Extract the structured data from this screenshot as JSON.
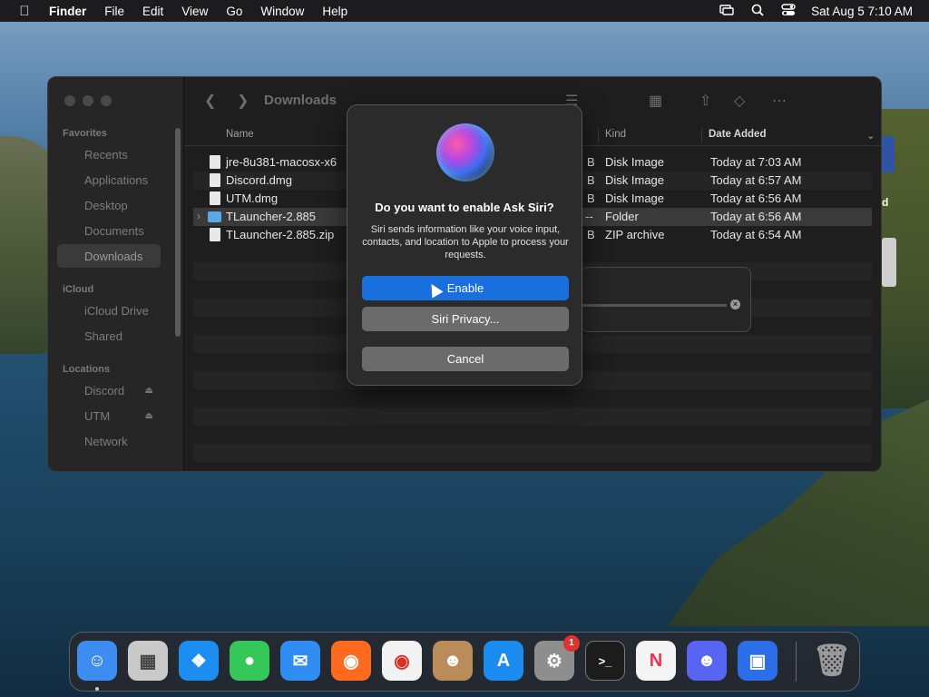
{
  "menubar": {
    "app_name": "Finder",
    "items": [
      "File",
      "Edit",
      "View",
      "Go",
      "Window",
      "Help"
    ],
    "clock": "Sat Aug 5  7:10 AM",
    "right_icons": [
      "screen-mirroring-icon",
      "search-icon",
      "control-center-icon"
    ]
  },
  "finder": {
    "title": "Downloads",
    "sidebar": {
      "favorites_label": "Favorites",
      "favorites": [
        "Recents",
        "Applications",
        "Desktop",
        "Documents",
        "Downloads"
      ],
      "icloud_label": "iCloud",
      "icloud": [
        "iCloud Drive",
        "Shared"
      ],
      "locations_label": "Locations",
      "locations": [
        "Discord",
        "UTM",
        "Network"
      ]
    },
    "columns": {
      "name": "Name",
      "kind": "Kind",
      "date_added": "Date Added"
    },
    "files": [
      {
        "name": "jre-8u381-macosx-x6",
        "size_tail": "B",
        "kind": "Disk Image",
        "date": "Today at 7:03 AM"
      },
      {
        "name": "Discord.dmg",
        "size_tail": "B",
        "kind": "Disk Image",
        "date": "Today at 6:57 AM"
      },
      {
        "name": "UTM.dmg",
        "size_tail": "B",
        "kind": "Disk Image",
        "date": "Today at 6:56 AM"
      },
      {
        "name": "TLauncher-2.885",
        "size_tail": "--",
        "kind": "Folder",
        "date": "Today at 6:56 AM"
      },
      {
        "name": "TLauncher-2.885.zip",
        "size_tail": "B",
        "kind": "ZIP archive",
        "date": "Today at 6:54 AM"
      }
    ]
  },
  "dialog": {
    "title": "Do you want to enable Ask Siri?",
    "body": "Siri sends information like your voice input, contacts, and location to Apple to process your requests.",
    "enable_label": "Enable",
    "privacy_label": "Siri Privacy...",
    "cancel_label": "Cancel"
  },
  "desktop": {
    "right_label": "d"
  },
  "dock": {
    "apps": [
      {
        "name": "Finder",
        "color": "#3d8df0"
      },
      {
        "name": "Launchpad",
        "color": "#c9c9c9"
      },
      {
        "name": "Safari",
        "color": "#1c8ef2"
      },
      {
        "name": "Messages",
        "color": "#34c759"
      },
      {
        "name": "Mail",
        "color": "#2f8cf0"
      },
      {
        "name": "Firefox",
        "color": "#ff6a1f"
      },
      {
        "name": "Chrome",
        "color": "#f2f2f2"
      },
      {
        "name": "Contacts",
        "color": "#b98c5a"
      },
      {
        "name": "App Store",
        "color": "#1a8cf0"
      },
      {
        "name": "System Settings",
        "color": "#8e8e8e"
      },
      {
        "name": "Terminal",
        "color": "#1c1c1c"
      },
      {
        "name": "News",
        "color": "#f4f4f4"
      },
      {
        "name": "Discord",
        "color": "#5865f2"
      },
      {
        "name": "UTM",
        "color": "#2b6ee8"
      }
    ],
    "settings_badge": "1",
    "trash_name": "Trash"
  }
}
